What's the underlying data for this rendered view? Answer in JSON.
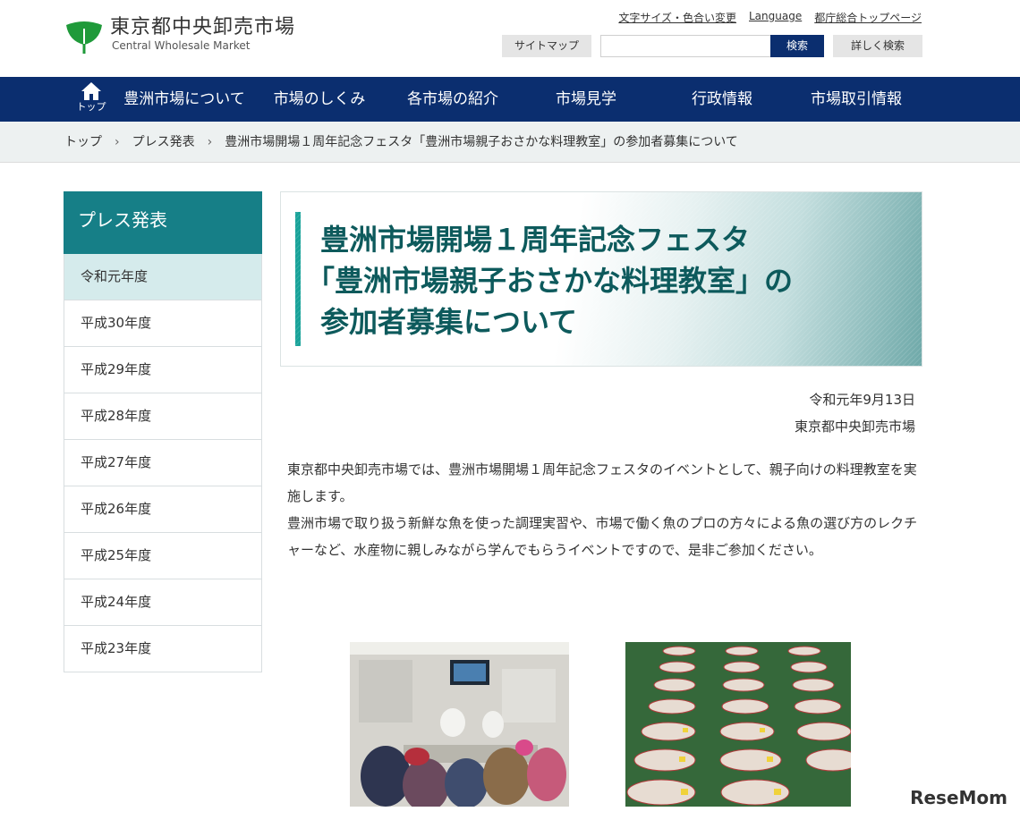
{
  "header": {
    "logo_jp": "東京都中央卸売市場",
    "logo_en": "Central Wholesale Market",
    "util_links": [
      "文字サイズ・色合い変更",
      "Language",
      "都庁総合トップページ"
    ],
    "sitemap_label": "サイトマップ",
    "search_placeholder": "",
    "search_button": "検索",
    "advanced_search": "詳しく検索",
    "logo_icon": "ginkgo-leaf-icon",
    "brand_color": "#0b2e6f"
  },
  "nav": {
    "home_label": "トップ",
    "items": [
      "豊洲市場について",
      "市場のしくみ",
      "各市場の紹介",
      "市場見学",
      "行政情報",
      "市場取引情報"
    ]
  },
  "breadcrumb": [
    "トップ",
    "プレス発表",
    "豊洲市場開場１周年記念フェスタ「豊洲市場親子おさかな料理教室」の参加者募集について"
  ],
  "sidebar": {
    "heading": "プレス発表",
    "items": [
      "令和元年度",
      "平成30年度",
      "平成29年度",
      "平成28年度",
      "平成27年度",
      "平成26年度",
      "平成25年度",
      "平成24年度",
      "平成23年度"
    ],
    "active_index": 0,
    "accent_color": "#167f87"
  },
  "article": {
    "title_lines": [
      "豊洲市場開場１周年記念フェスタ",
      "「豊洲市場親子おさかな料理教室」の",
      "参加者募集について"
    ],
    "date": "令和元年9月13日",
    "org": "東京都中央卸売市場",
    "paragraphs": [
      "東京都中央卸売市場では、豊洲市場開場１周年記念フェスタのイベントとして、親子向けの料理教室を実施します。",
      "豊洲市場で取り扱う新鮮な魚を使った調理実習や、市場で働く魚のプロの方々による魚の選び方のレクチャーなど、水産物に親しみながら学んでもらうイベントですので、是非ご参加ください。"
    ]
  },
  "watermark": "ReseMom"
}
